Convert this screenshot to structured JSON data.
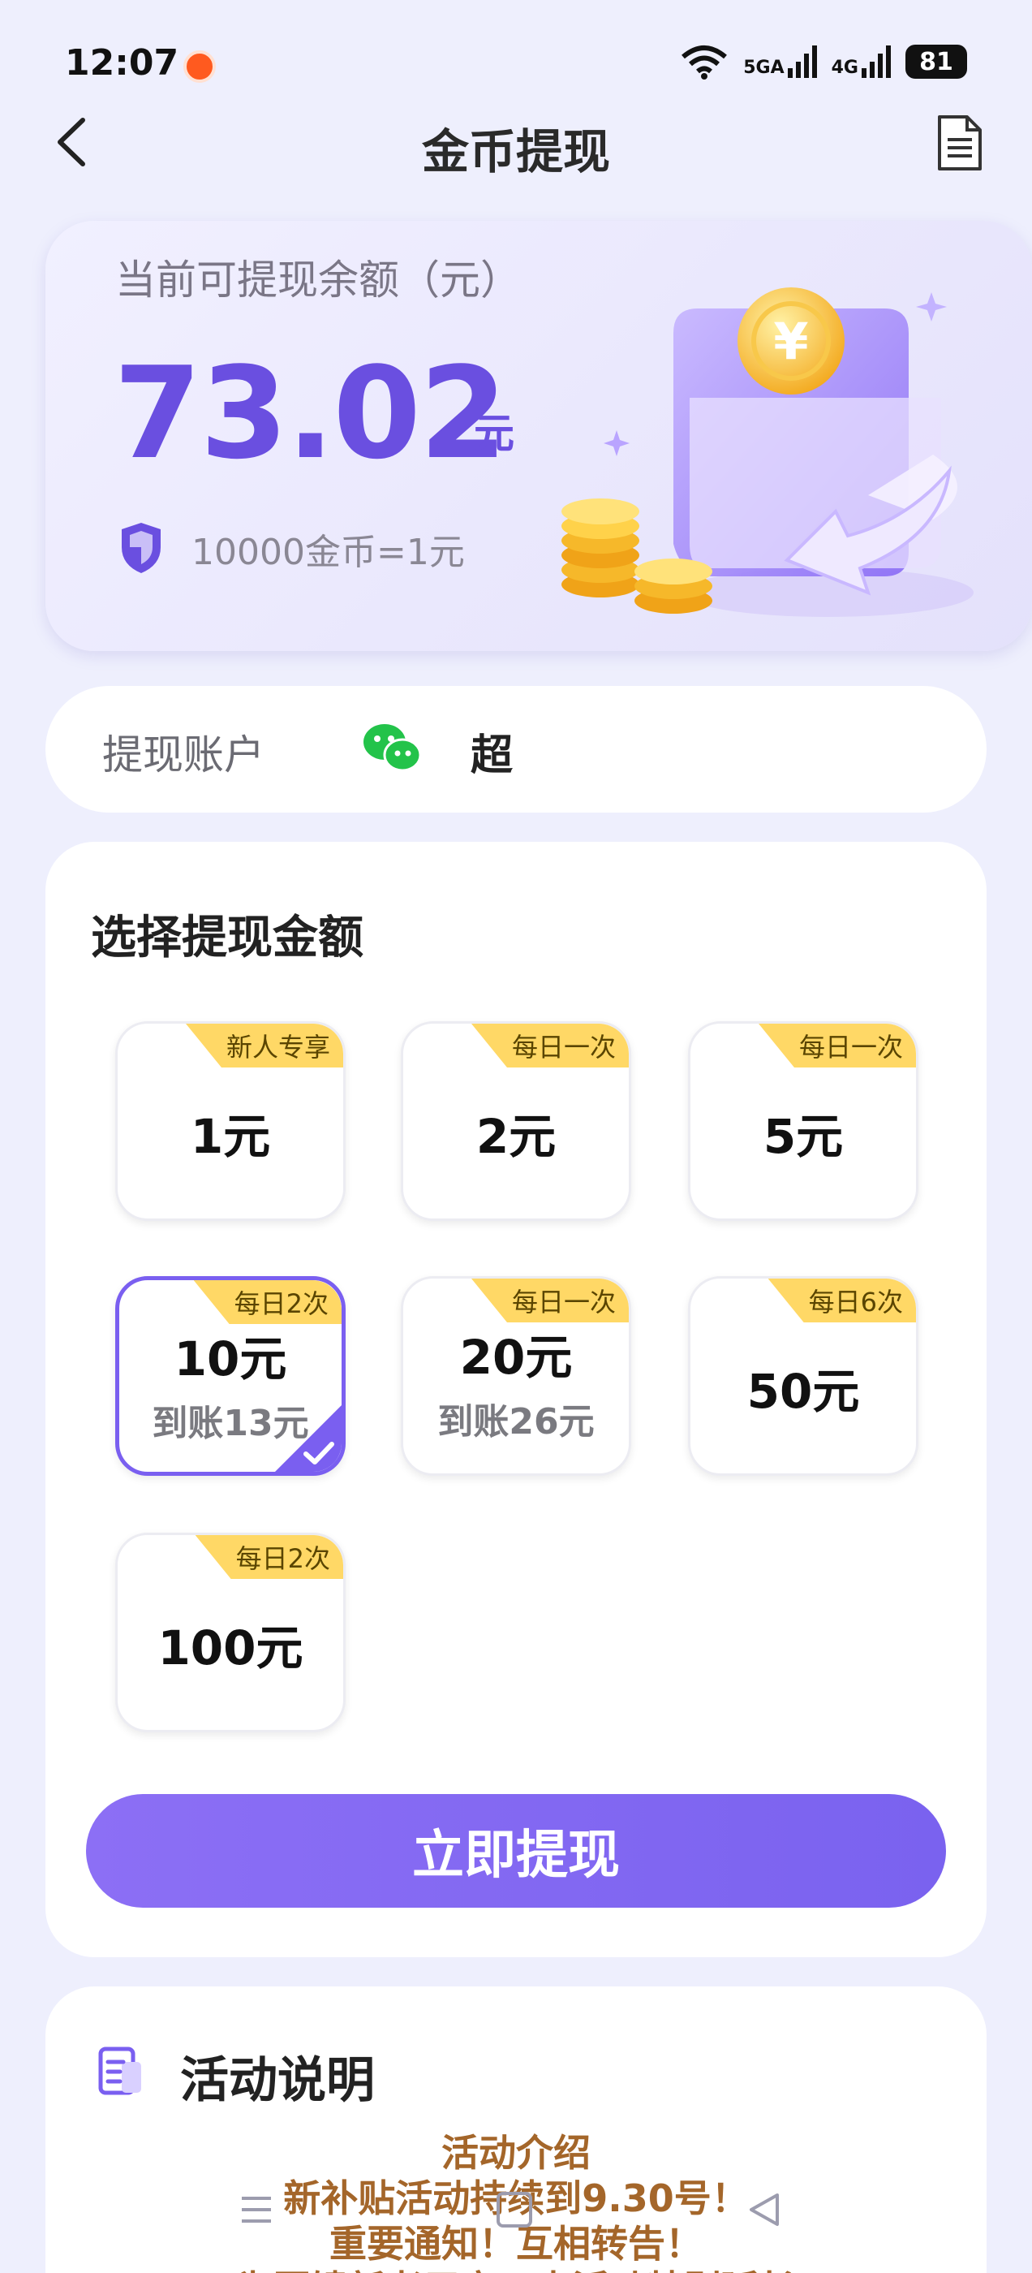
{
  "status_bar": {
    "time": "12:07",
    "signal_1": "5GA",
    "signal_2": "4G",
    "battery": "81"
  },
  "header": {
    "title": "金币提现"
  },
  "balance": {
    "label": "当前可提现余额（元）",
    "amount": "73.02",
    "unit": "元",
    "exchange_rate": "10000金币=1元"
  },
  "account": {
    "label": "提现账户",
    "name": "超"
  },
  "amount_section": {
    "title": "选择提现金额",
    "options": [
      {
        "amount": "1元",
        "badge": "新人专享",
        "sub": "",
        "selected": false
      },
      {
        "amount": "2元",
        "badge": "每日一次",
        "sub": "",
        "selected": false
      },
      {
        "amount": "5元",
        "badge": "每日一次",
        "sub": "",
        "selected": false
      },
      {
        "amount": "10元",
        "badge": "每日2次",
        "sub": "到账13元",
        "selected": true
      },
      {
        "amount": "20元",
        "badge": "每日一次",
        "sub": "到账26元",
        "selected": false
      },
      {
        "amount": "50元",
        "badge": "每日6次",
        "sub": "",
        "selected": false
      },
      {
        "amount": "100元",
        "badge": "每日2次",
        "sub": "",
        "selected": false
      }
    ],
    "button": "立即提现"
  },
  "activity": {
    "title": "活动说明",
    "lines": [
      "活动介绍",
      "新补贴活动持续到9.30号！",
      "重要通知！互相转告！",
      "为回馈新老用户，本活动特别延长"
    ]
  },
  "colors": {
    "accent": "#6a4fe0",
    "badge": "#ffd866",
    "activity_text": "#a4662a"
  }
}
